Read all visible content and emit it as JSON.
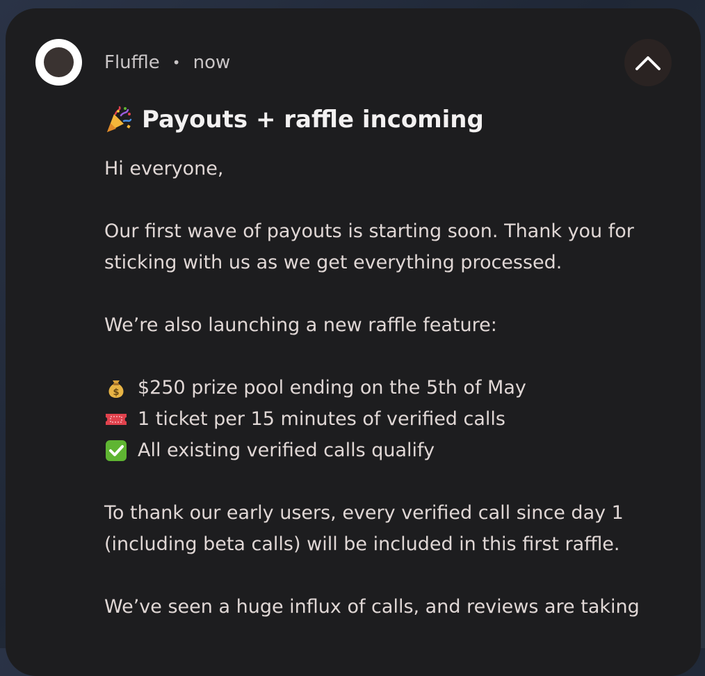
{
  "notification": {
    "app_name": "Fluffle",
    "separator": "•",
    "time": "now",
    "app_icon": "circle-logo-icon",
    "collapse_icon": "chevron-up-icon",
    "title_emoji": "party-popper-icon",
    "title": "Payouts + raffle incoming",
    "greeting": "Hi everyone,",
    "paragraph1_line1": "Our first wave of payouts is starting soon. Thank you for",
    "paragraph1_line2": "sticking with us as we get everything processed.",
    "paragraph2": "We’re also launching a new raffle feature:",
    "bullets": [
      {
        "icon": "money-bag-icon",
        "text": "$250 prize pool ending on the 5th of May"
      },
      {
        "icon": "ticket-icon",
        "text": "1 ticket per 15 minutes of verified calls"
      },
      {
        "icon": "check-mark-icon",
        "text": "All existing verified calls qualify"
      }
    ],
    "paragraph3_line1": "To thank our early users, every verified call since day 1",
    "paragraph3_line2": "(including beta calls) will be included in this first raffle.",
    "paragraph4_line1": "We’ve seen a huge influx of calls, and reviews are taking"
  },
  "colors": {
    "card_background": "#1d1d1f",
    "title_text": "#f3f1f1",
    "body_text": "#e0d7d5",
    "secondary_text": "#c9c5c6",
    "check_green": "#5fb532",
    "ticket_red": "#e0424d"
  }
}
